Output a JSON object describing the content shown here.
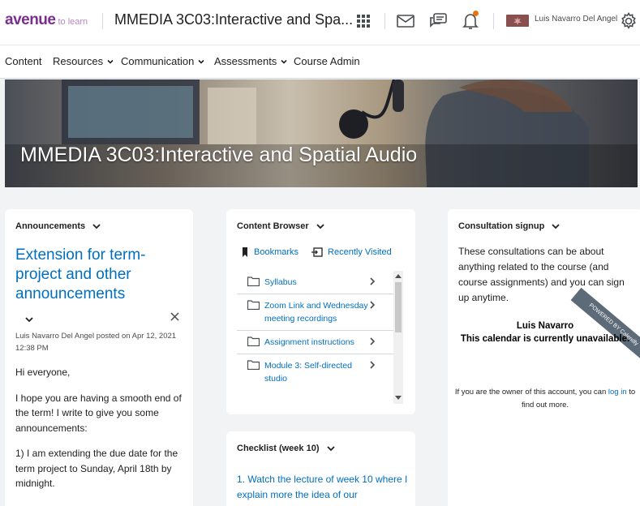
{
  "header": {
    "logo_main": "avenue",
    "logo_sub": "to learn",
    "course_title": "MMEDIA 3C03:Interactive and Spa...",
    "user_name": "Luis Navarro Del Angel",
    "icons": [
      "grid-icon",
      "mail-icon",
      "chat-icon",
      "bell-icon",
      "gear-icon"
    ]
  },
  "nav": {
    "content": "Content",
    "resources": "Resources",
    "communication": "Communication",
    "assessments": "Assessments",
    "course_admin": "Course Admin"
  },
  "banner": {
    "title": "MMEDIA 3C03:Interactive and Spatial Audio"
  },
  "announcements": {
    "header": "Announcements",
    "title": "Extension for term-project and other announcements",
    "meta": "Luis Navarro Del Angel posted on Apr 12, 2021 12:38 PM",
    "para1": "Hi everyone,",
    "para2": "I hope you are having a smooth end of the term! I write to give you some announcements:",
    "para3": "1) I am extending the due date for the term project to Sunday, April 18th by midnight."
  },
  "content_browser": {
    "header": "Content Browser",
    "bookmarks": "Bookmarks",
    "recently_visited": "Recently Visited",
    "items": [
      "Syllabus",
      "Zoom Link and Wednesday meeting recordings",
      "Assignment instructions",
      "Module 3: Self-directed studio"
    ]
  },
  "consultation": {
    "header": "Consultation signup",
    "text": "These consultations can be about anything related to the course (and course assignments) and you can sign up anytime.",
    "name": "Luis Navarro",
    "unavailable": "This calendar is currently unavailable.",
    "badge": "POWERED BY Calendly",
    "owner_pre": "If you are the owner of this account, you can",
    "owner_link": "log in",
    "owner_post": "to find out more."
  },
  "checklist": {
    "header": "Checklist (week 10)",
    "item1": "1. Watch the lecture of week 10 where I explain more the idea of our"
  },
  "colors": {
    "link": "#006fbf",
    "brand": "#7a2e8e",
    "notification": "#e87511"
  }
}
